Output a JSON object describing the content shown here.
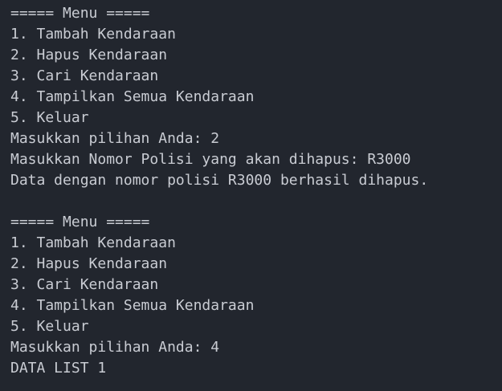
{
  "terminal": {
    "lines": [
      "===== Menu =====",
      "1. Tambah Kendaraan",
      "2. Hapus Kendaraan",
      "3. Cari Kendaraan",
      "4. Tampilkan Semua Kendaraan",
      "5. Keluar",
      "Masukkan pilihan Anda: 2",
      "Masukkan Nomor Polisi yang akan dihapus: R3000",
      "Data dengan nomor polisi R3000 berhasil dihapus.",
      "",
      "===== Menu =====",
      "1. Tambah Kendaraan",
      "2. Hapus Kendaraan",
      "3. Cari Kendaraan",
      "4. Tampilkan Semua Kendaraan",
      "5. Keluar",
      "Masukkan pilihan Anda: 4",
      "DATA LIST 1"
    ]
  }
}
